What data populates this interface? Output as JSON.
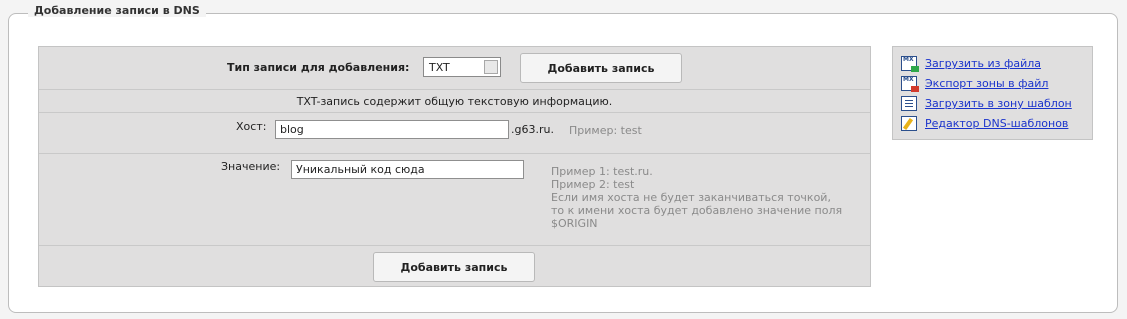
{
  "fieldset": {
    "legend": "Добавление записи в DNS"
  },
  "form": {
    "record_type_label": "Тип записи для добавления:",
    "record_type_value": "TXT",
    "add_button_label": "Добавить запись",
    "description": "TXT-запись содержит общую текстовую информацию.",
    "host": {
      "label": "Хост:",
      "value": "blog",
      "suffix": ".g63.ru.",
      "hint": "Пример: test"
    },
    "value_field": {
      "label": "Значение:",
      "value": "Уникальный код сюда",
      "hints": [
        "Пример 1: test.ru.",
        "Пример 2: test",
        "Если имя хоста не будет заканчиваться точкой,",
        "то к имени хоста будет добавлено значение поля",
        "$ORIGIN"
      ]
    },
    "submit_button_label": "Добавить запись"
  },
  "sidebar": {
    "items": [
      {
        "label": "Загрузить из файла",
        "icon": "import-file-icon"
      },
      {
        "label": "Экспорт зоны в файл",
        "icon": "export-zone-icon"
      },
      {
        "label": "Загрузить в зону шаблон",
        "icon": "load-template-icon"
      },
      {
        "label": "Редактор DNS-шаблонов",
        "icon": "template-editor-icon"
      }
    ]
  }
}
